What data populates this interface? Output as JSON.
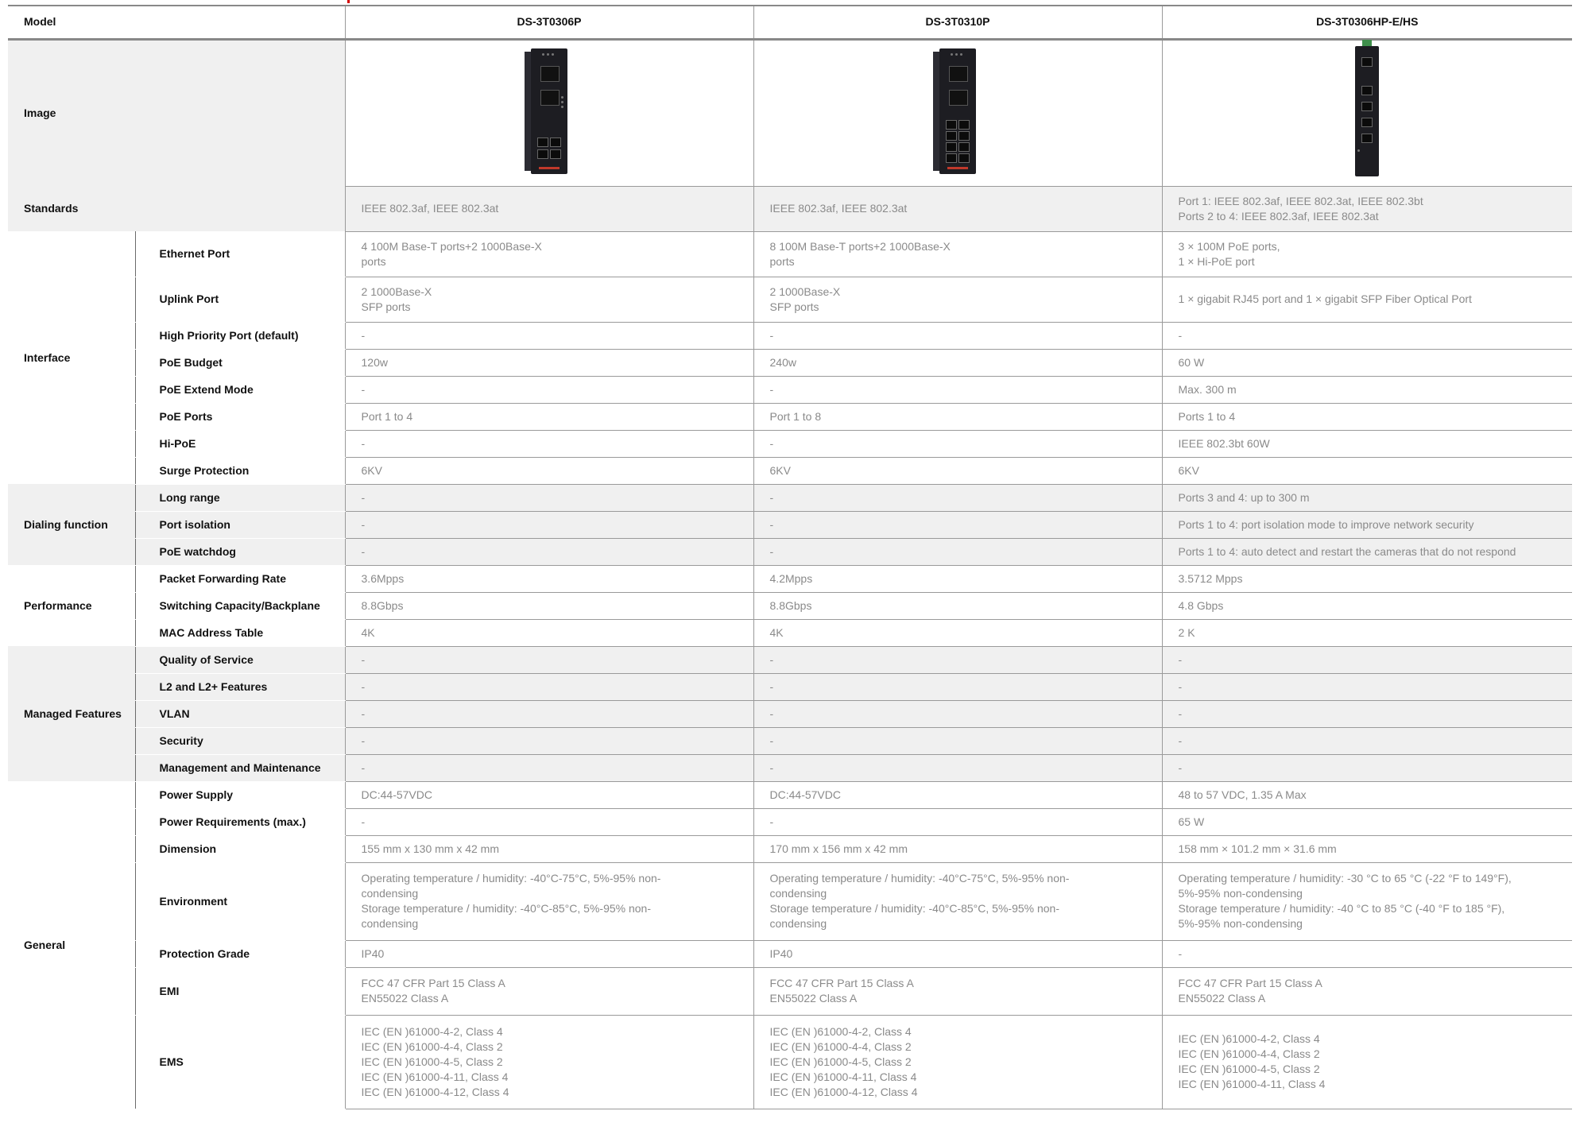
{
  "header": {
    "model_label": "Model",
    "models": [
      "DS-3T0306P",
      "DS-3T0310P",
      "DS-3T0306HP-E/HS"
    ]
  },
  "image_row": {
    "label": "Image",
    "images": [
      "switch-din-rail-6port-image",
      "switch-din-rail-10port-image",
      "switch-din-rail-6port-hipoe-image"
    ]
  },
  "rows": {
    "standards": {
      "label": "Standards",
      "values": [
        "IEEE 802.3af, IEEE 802.3at",
        "IEEE 802.3af, IEEE 802.3at",
        "Port 1: IEEE 802.3af, IEEE 802.3at, IEEE 802.3bt\nPorts 2 to 4: IEEE 802.3af, IEEE 802.3at"
      ]
    },
    "interface_group": "Interface",
    "ethernet_port": {
      "label": "Ethernet Port",
      "values": [
        "4 100M Base-T ports+2 1000Base-X\nports",
        "8 100M Base-T ports+2 1000Base-X\nports",
        "3 × 100M PoE ports,\n1 × Hi-PoE port"
      ]
    },
    "uplink_port": {
      "label": "Uplink Port",
      "values": [
        "2 1000Base-X\n SFP ports",
        "2 1000Base-X\n SFP ports",
        "1 × gigabit RJ45 port and 1 × gigabit SFP Fiber Optical Port"
      ]
    },
    "high_priority_port": {
      "label": "High Priority Port (default)",
      "values": [
        "-",
        "-",
        "-"
      ]
    },
    "poe_budget": {
      "label": "PoE Budget",
      "values": [
        "120w",
        "240w",
        "60 W"
      ]
    },
    "poe_extend_mode": {
      "label": "PoE Extend Mode",
      "values": [
        "-",
        "-",
        "Max. 300 m"
      ]
    },
    "poe_ports": {
      "label": "PoE Ports",
      "values": [
        "Port 1 to 4",
        "Port 1 to 8",
        "Ports 1 to 4"
      ]
    },
    "hi_poe": {
      "label": "Hi-PoE",
      "values": [
        "-",
        "-",
        "IEEE 802.3bt  60W"
      ]
    },
    "surge_protection": {
      "label": "Surge Protection",
      "values": [
        "6KV",
        "6KV",
        "6KV"
      ]
    },
    "dialing_group": "Dialing function",
    "long_range": {
      "label": "Long range",
      "values": [
        "-",
        "-",
        "Ports 3 and 4: up to 300 m"
      ]
    },
    "port_isolation": {
      "label": "Port isolation",
      "values": [
        "-",
        "-",
        "Ports 1 to 4: port isolation mode to improve network security"
      ]
    },
    "poe_watchdog": {
      "label": "PoE watchdog",
      "values": [
        "-",
        "-",
        "Ports 1 to 4: auto detect and restart the cameras that do not respond"
      ]
    },
    "performance_group": "Performance",
    "packet_forwarding": {
      "label": "Packet Forwarding Rate",
      "values": [
        "3.6Mpps",
        "4.2Mpps",
        "3.5712 Mpps"
      ]
    },
    "switching_capacity": {
      "label": "Switching Capacity/Backplane",
      "values": [
        "8.8Gbps",
        "8.8Gbps",
        "4.8 Gbps"
      ]
    },
    "mac_table": {
      "label": "MAC Address Table",
      "values": [
        "4K",
        "4K",
        "2 K"
      ]
    },
    "managed_group": "Managed Features",
    "qos": {
      "label": "Quality of Service",
      "values": [
        "-",
        "-",
        "-"
      ]
    },
    "l2_features": {
      "label": "L2 and L2+ Features",
      "values": [
        "-",
        "-",
        "-"
      ]
    },
    "vlan": {
      "label": "VLAN",
      "values": [
        "-",
        "-",
        "-"
      ]
    },
    "security": {
      "label": "Security",
      "values": [
        "-",
        "-",
        "-"
      ]
    },
    "mgmt": {
      "label": "Management and Maintenance",
      "values": [
        "-",
        "-",
        "-"
      ]
    },
    "general_group": "General",
    "power_supply": {
      "label": "Power Supply",
      "values": [
        "DC:44-57VDC",
        "DC:44-57VDC",
        "48 to 57 VDC, 1.35 A Max"
      ]
    },
    "power_req": {
      "label": "Power Requirements (max.)",
      "values": [
        "-",
        "-",
        "65 W"
      ]
    },
    "dimension": {
      "label": "Dimension",
      "values": [
        "155 mm x 130 mm x 42 mm",
        "170 mm x 156 mm x 42 mm",
        "158 mm × 101.2 mm × 31.6 mm"
      ]
    },
    "environment": {
      "label": "Environment",
      "values": [
        "Operating temperature / humidity: -40°C-75°C, 5%-95% non-\ncondensing\nStorage temperature / humidity: -40°C-85°C, 5%-95% non-\ncondensing",
        "Operating temperature / humidity: -40°C-75°C, 5%-95% non-\ncondensing\nStorage temperature / humidity: -40°C-85°C, 5%-95% non-\ncondensing",
        "Operating temperature / humidity: -30 °C to 65 °C (-22 °F to  149°F),\n5%-95% non-condensing\nStorage temperature / humidity: -40 °C to 85 °C (-40 °F to 185 °F),\n5%-95% non-condensing"
      ]
    },
    "protection_grade": {
      "label": "Protection Grade",
      "values": [
        "IP40",
        "IP40",
        "-"
      ]
    },
    "emi": {
      "label": "EMI",
      "values": [
        "FCC 47 CFR Part 15 Class A\nEN55022 Class A",
        "FCC 47 CFR Part 15 Class A\nEN55022 Class A",
        "FCC 47 CFR Part 15 Class A\nEN55022 Class A"
      ]
    },
    "ems": {
      "label": "EMS",
      "values": [
        "IEC (EN )61000-4-2, Class 4\nIEC (EN )61000-4-4, Class 2\nIEC (EN )61000-4-5, Class 2\nIEC (EN )61000-4-11, Class 4\nIEC (EN )61000-4-12, Class 4",
        "IEC (EN )61000-4-2, Class 4\nIEC (EN )61000-4-4, Class 2\nIEC (EN )61000-4-5, Class 2\nIEC (EN )61000-4-11, Class 4\nIEC (EN )61000-4-12, Class 4",
        "IEC (EN )61000-4-2, Class 4\nIEC (EN )61000-4-4, Class 2\nIEC (EN )61000-4-5, Class 2\nIEC (EN )61000-4-11, Class 4"
      ]
    }
  }
}
